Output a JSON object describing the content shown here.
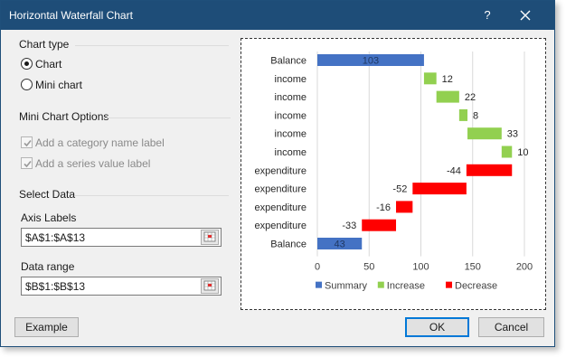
{
  "window": {
    "title": "Horizontal Waterfall Chart",
    "help_label": "?",
    "close_icon": "close-icon"
  },
  "chart_type": {
    "label": "Chart type",
    "options": [
      "Chart",
      "Mini chart"
    ],
    "selected": "Chart"
  },
  "mini_chart_options": {
    "label": "Mini Chart Options",
    "category_label": "Add a category name label",
    "series_label": "Add a series value label",
    "category_checked": true,
    "series_checked": true,
    "disabled": true
  },
  "select_data": {
    "label": "Select Data",
    "axis_labels_label": "Axis Labels",
    "axis_labels_value": "$A$1:$A$13",
    "data_range_label": "Data range",
    "data_range_value": "$B$1:$B$13",
    "range_icon": "range-select-icon"
  },
  "buttons": {
    "example": "Example",
    "ok": "OK",
    "cancel": "Cancel"
  },
  "colors": {
    "summary": "#4472c4",
    "increase": "#92d050",
    "decrease": "#ff0000",
    "titlebar": "#1e4d78"
  },
  "chart_data": {
    "type": "bar",
    "orientation": "horizontal",
    "categories": [
      "Balance",
      "income",
      "income",
      "income",
      "income",
      "income",
      "expenditure",
      "expenditure",
      "expenditure",
      "expenditure",
      "Balance"
    ],
    "values": [
      103,
      12,
      22,
      8,
      33,
      10,
      -44,
      -52,
      -16,
      -33,
      43
    ],
    "kinds": [
      "summary",
      "increase",
      "increase",
      "increase",
      "increase",
      "increase",
      "decrease",
      "decrease",
      "decrease",
      "decrease",
      "summary"
    ],
    "data_labels": [
      "103",
      "12",
      "22",
      "8",
      "33",
      "10",
      "-44",
      "-52",
      "-16",
      "-33",
      "43"
    ],
    "xlim": [
      0,
      200
    ],
    "xticks": [
      "0",
      "50",
      "100",
      "150",
      "200"
    ],
    "grid": true,
    "legend_position": "bottom",
    "legend": [
      {
        "name": "Summary",
        "kind": "summary"
      },
      {
        "name": "Increase",
        "kind": "increase"
      },
      {
        "name": "Decrease",
        "kind": "decrease"
      }
    ]
  }
}
